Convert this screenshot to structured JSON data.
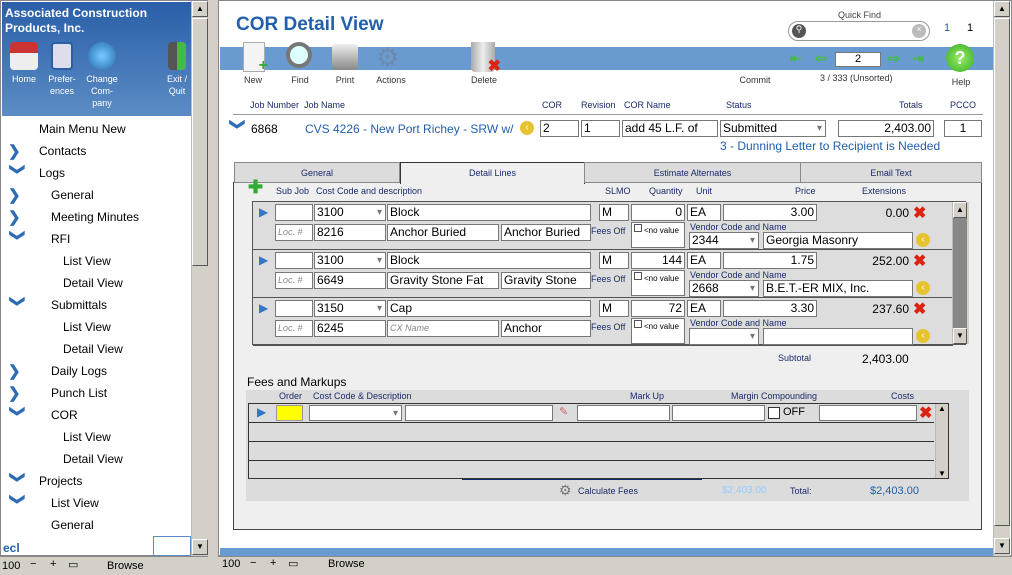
{
  "sidebar": {
    "company": "Associated Construction Products, Inc.",
    "nav_buttons": [
      {
        "label": "Home",
        "icon": "home-icon"
      },
      {
        "label": "Prefer-ences",
        "icon": "clipboard-icon"
      },
      {
        "label": "Change Com-pany",
        "icon": "change-icon"
      },
      {
        "label": "Exit / Quit",
        "icon": "exit-door-icon"
      }
    ],
    "items": [
      {
        "label": "Main Menu New",
        "level": 0,
        "icon": "none"
      },
      {
        "label": "Contacts",
        "level": 0,
        "icon": "chevron-right"
      },
      {
        "label": "Logs",
        "level": 0,
        "icon": "chevron-down"
      },
      {
        "label": "General",
        "level": 1,
        "icon": "chevron-right"
      },
      {
        "label": "Meeting Minutes",
        "level": 1,
        "icon": "chevron-right"
      },
      {
        "label": "RFI",
        "level": 1,
        "icon": "chevron-down"
      },
      {
        "label": "List View",
        "level": 2,
        "icon": "none"
      },
      {
        "label": "Detail View",
        "level": 2,
        "icon": "none"
      },
      {
        "label": "Submittals",
        "level": 1,
        "icon": "chevron-down"
      },
      {
        "label": "List View",
        "level": 2,
        "icon": "none"
      },
      {
        "label": "Detail View",
        "level": 2,
        "icon": "none"
      },
      {
        "label": "Daily Logs",
        "level": 1,
        "icon": "chevron-right"
      },
      {
        "label": "Punch List",
        "level": 1,
        "icon": "chevron-right"
      },
      {
        "label": "COR",
        "level": 1,
        "icon": "chevron-down"
      },
      {
        "label": "List View",
        "level": 2,
        "icon": "none"
      },
      {
        "label": "Detail View",
        "level": 2,
        "icon": "none"
      },
      {
        "label": "Projects",
        "level": 0,
        "icon": "chevron-down"
      },
      {
        "label": "List View",
        "level": 1,
        "icon": "chevron-down"
      },
      {
        "label": "General",
        "level": 1,
        "icon": "none"
      }
    ],
    "footer_text": "ecl"
  },
  "status_left": {
    "zoom": "100",
    "mode": "Browse"
  },
  "status_right": {
    "zoom": "100",
    "mode": "Browse"
  },
  "header": {
    "title": "COR Detail View",
    "quick_find_label": "Quick Find",
    "quick_find_value": "",
    "count_a": "1",
    "count_b": "1"
  },
  "toolbar": {
    "new": "New",
    "find": "Find",
    "print": "Print",
    "actions": "Actions",
    "delete": "Delete",
    "commit": "Commit",
    "help": "Help",
    "record_input": "2",
    "record_status": "3 / 333 (Unsorted)"
  },
  "record": {
    "headers": {
      "job_number": "Job Number",
      "job_name": "Job Name",
      "cor": "COR",
      "revision": "Revision",
      "cor_name": "COR Name",
      "status": "Status",
      "totals": "Totals",
      "pcco": "PCCO"
    },
    "job_number": "6868",
    "job_name": "CVS 4226 - New Port Richey - SRW w/",
    "cor": "2",
    "revision": "1",
    "cor_name": "add 45 L.F. of",
    "status": "Submitted",
    "totals": "2,403.00",
    "pcco": "1",
    "notice": "3 - Dunning Letter to Recipient is Needed"
  },
  "tabs": [
    {
      "label": "General"
    },
    {
      "label": "Detail Lines",
      "active": true
    },
    {
      "label": "Estimate Alternates"
    },
    {
      "label": "Email Text"
    }
  ],
  "detail": {
    "headers": {
      "sub_job": "Sub Job",
      "cost_code": "Cost Code and description",
      "slmo": "SLMO",
      "quantity": "Quantity",
      "unit": "Unit",
      "price": "Price",
      "extensions": "Extensions"
    },
    "loc_placeholder": "Loc. #",
    "fees_off": "Fees Off",
    "no_value": "<no value",
    "vendor_label": "Vendor Code and Name",
    "lines": [
      {
        "sub_job": "",
        "cost_code": "3100",
        "description": "Block",
        "slmo": "M",
        "quantity": "0",
        "unit": "EA",
        "price": "3.00",
        "extension": "0.00",
        "code2": "8216",
        "name1": "Anchor Buried",
        "name2": "Anchor  Buried",
        "vendor_code": "2344",
        "vendor_name": "Georgia Masonry"
      },
      {
        "sub_job": "",
        "cost_code": "3100",
        "description": "Block",
        "slmo": "M",
        "quantity": "144",
        "unit": "EA",
        "price": "1.75",
        "extension": "252.00",
        "code2": "6649",
        "name1": "Gravity Stone Fat",
        "name2": "Gravity Stone",
        "vendor_code": "2668",
        "vendor_name": "B.E.T.-ER MIX, Inc."
      },
      {
        "sub_job": "",
        "cost_code": "3150",
        "description": "Cap",
        "slmo": "M",
        "quantity": "72",
        "unit": "EA",
        "price": "3.30",
        "extension": "237.60",
        "code2": "6245",
        "name1_placeholder": "CX Name",
        "name2": "Anchor",
        "vendor_code": "",
        "vendor_name": ""
      }
    ],
    "subtotal_label": "Subtotal",
    "subtotal": "2,403.00"
  },
  "fees": {
    "title": "Fees and Markups",
    "headers": {
      "order": "Order",
      "cost_code": "Cost Code & Description",
      "mark_up": "Mark Up",
      "margin": "Margin Compounding",
      "costs": "Costs"
    },
    "off_label": "OFF",
    "calculate": "Calculate Fees",
    "faded_total": "$2,403.00",
    "total_label": "Total:",
    "total": "$2,403.00",
    "order_color": "#ffff00"
  },
  "colors": {
    "accent": "#2160ad",
    "band": "#6a9bd0",
    "delete": "#d21"
  }
}
